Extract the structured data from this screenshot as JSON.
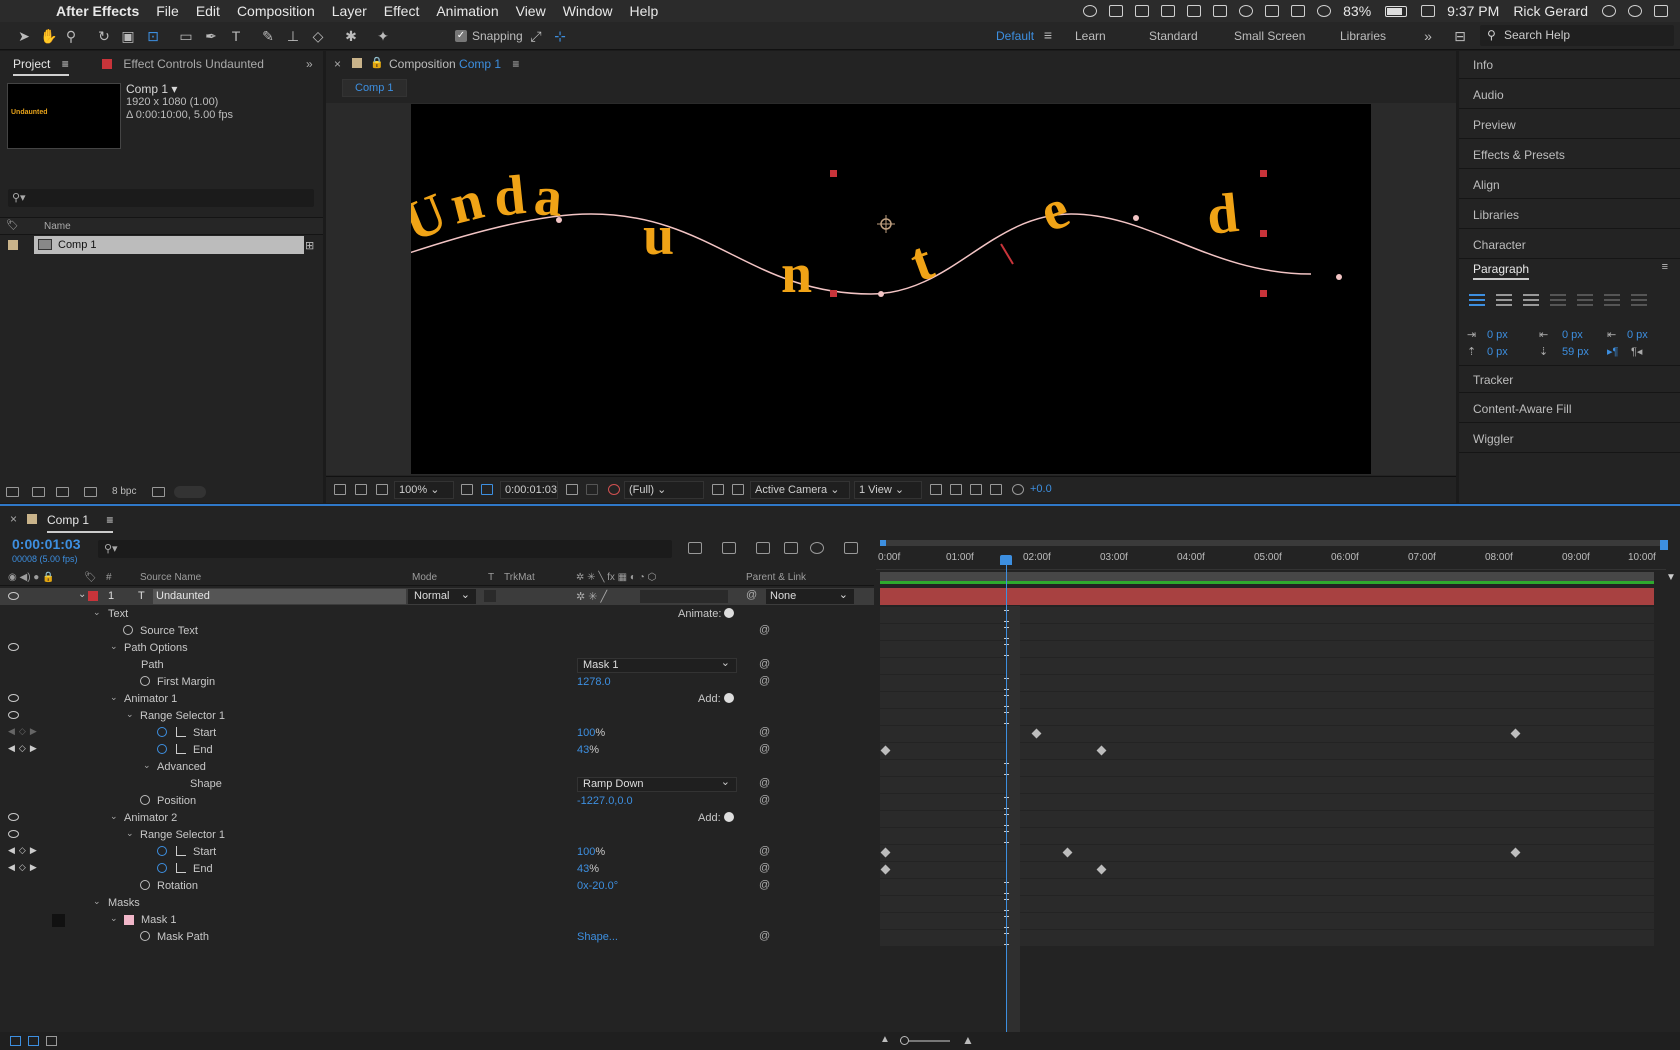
{
  "menubar": {
    "app_name": "After Effects",
    "menus": [
      "File",
      "Edit",
      "Composition",
      "Layer",
      "Effect",
      "Animation",
      "View",
      "Window",
      "Help"
    ],
    "battery": "83%",
    "clock": "9:37 PM",
    "user": "Rick Gerard"
  },
  "toolbar": {
    "snapping_label": "Snapping",
    "workspaces": [
      "Default",
      "Learn",
      "Standard",
      "Small Screen",
      "Libraries"
    ],
    "active_workspace": "Default",
    "search_placeholder": "Search Help"
  },
  "project": {
    "tab_project": "Project",
    "tab_effect_controls": "Effect Controls Undaunted",
    "thumb_text": "Undaunted",
    "comp_name": "Comp 1 ▾",
    "comp_resolution": "1920 x 1080 (1.00)",
    "comp_duration": "Δ 0:00:10:00, 5.00 fps",
    "col_name": "Name",
    "item_name": "Comp 1",
    "bpc": "8 bpc"
  },
  "composition": {
    "tab_prefix": "Composition",
    "tab_comp": "Comp 1",
    "crumb": "Comp 1",
    "text_letters": [
      "U",
      "n",
      "d",
      "a",
      "u",
      "n",
      "t",
      "e",
      "d"
    ],
    "footer": {
      "zoom": "100%",
      "timecode": "0:00:01:03",
      "resolution": "(Full)",
      "camera": "Active Camera",
      "view": "1 View",
      "exposure": "+0.0"
    }
  },
  "right_panels": {
    "items_top": [
      "Info",
      "Audio",
      "Preview",
      "Effects & Presets",
      "Align",
      "Libraries",
      "Character"
    ],
    "paragraph_title": "Paragraph",
    "indent_values": [
      "0 px",
      "0 px",
      "0 px",
      "0 px",
      "59 px"
    ],
    "items_bottom": [
      "Tracker",
      "Content-Aware Fill",
      "Wiggler"
    ]
  },
  "timeline": {
    "tab": "Comp 1",
    "timecode": "0:00:01:03",
    "fps": "00008 (5.00 fps)",
    "columns": {
      "num": "#",
      "source_name": "Source Name",
      "mode": "Mode",
      "t": "T",
      "trkmat": "TrkMat",
      "parent": "Parent & Link"
    },
    "layer": {
      "index": "1",
      "type_icon": "T",
      "name": "Undaunted",
      "mode": "Normal",
      "parent": "None"
    },
    "properties": {
      "text": "Text",
      "animate": "Animate:",
      "source_text": "Source Text",
      "path_options": "Path Options",
      "path": "Path",
      "path_value": "Mask 1",
      "first_margin": "First Margin",
      "first_margin_value": "1278.0",
      "animator1": "Animator 1",
      "add": "Add:",
      "range_selector1": "Range Selector 1",
      "start": "Start",
      "start_value": "100",
      "end": "End",
      "end_value": "43",
      "percent": "%",
      "advanced": "Advanced",
      "shape": "Shape",
      "shape_value": "Ramp Down",
      "position": "Position",
      "position_value": "-1227.0,0.0",
      "animator2": "Animator 2",
      "range_selector1b": "Range Selector 1",
      "start2": "Start",
      "start2_value": "100",
      "end2": "End",
      "end2_value": "43",
      "rotation": "Rotation",
      "rotation_value": "0x-20.0°",
      "masks": "Masks",
      "mask1": "Mask 1",
      "mask_path": "Mask Path",
      "mask_path_value": "Shape..."
    },
    "ruler_labels": [
      "0:00f",
      "01:00f",
      "02:00f",
      "03:00f",
      "04:00f",
      "05:00f",
      "06:00f",
      "07:00f",
      "08:00f",
      "09:00f",
      "10:00f"
    ]
  },
  "colors": {
    "accent": "#3d8fe0",
    "layer_bar": "#a84141",
    "text_fill": "#f0a316",
    "mask_path": "#f2c4c4",
    "label_red": "#c8343a",
    "label_pink": "#f0b6c8"
  }
}
